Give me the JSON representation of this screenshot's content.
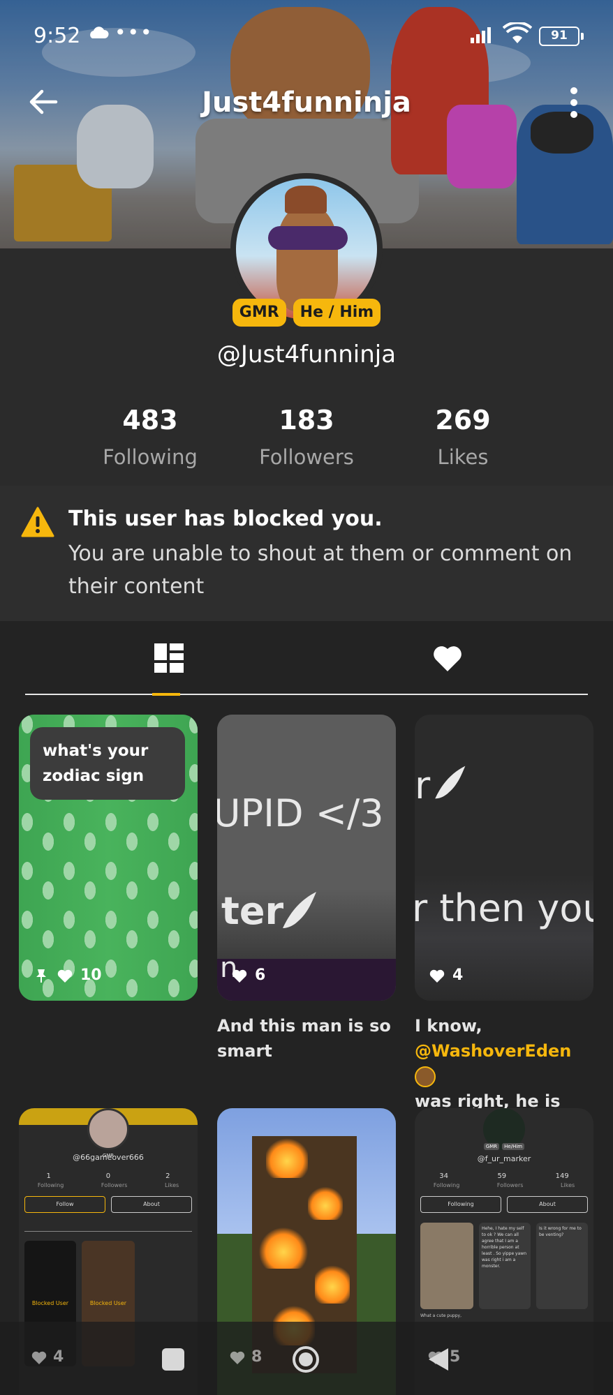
{
  "status_bar": {
    "time": "9:52",
    "dots": "•••",
    "battery": "91"
  },
  "header": {
    "title": "Just4funninja"
  },
  "profile": {
    "badges": [
      "GMR",
      "He / Him"
    ],
    "handle": "@Just4funninja",
    "stats": [
      {
        "value": "483",
        "label": "Following"
      },
      {
        "value": "183",
        "label": "Followers"
      },
      {
        "value": "269",
        "label": "Likes"
      }
    ]
  },
  "notice": {
    "title": "This user has blocked you.",
    "body": "You are unable to shout at them or comment on their content"
  },
  "tabs": [
    {
      "icon": "grid-icon",
      "active": true
    },
    {
      "icon": "heart-icon",
      "active": false
    }
  ],
  "colors": {
    "accent": "#f6b70d",
    "background": "#232323",
    "surface": "#2e2e2e"
  },
  "posts": [
    {
      "bubble": "what's your zodiac sign",
      "likes": "10",
      "caption": ""
    },
    {
      "overlay_top": "UPID </3",
      "overlay_mid": "ter",
      "overlay_bottom": "n",
      "likes": "6",
      "caption": "And this man is so smart"
    },
    {
      "overlay_top": "r",
      "overlay_mid": "r then you,",
      "likes": "4",
      "caption_prefix": "I know, ",
      "caption_mention": "@WashoverEden",
      "caption_suffix": "was right, he is old..."
    },
    {
      "mini_handle": "@66gameover666",
      "mini_badge": "GMR",
      "mini_stats": [
        [
          "1",
          "Following"
        ],
        [
          "0",
          "Followers"
        ],
        [
          "2",
          "Likes"
        ]
      ],
      "mini_follow": "Follow",
      "mini_about": "About",
      "mini_blocked_1": "Blocked User",
      "mini_blocked_2": "Blocked User",
      "likes": "4"
    },
    {
      "likes": "8"
    },
    {
      "mini_handle": "@f_ur_marker",
      "mini_badges": [
        "GMR",
        "He/Him"
      ],
      "mini_stats": [
        [
          "34",
          "Following"
        ],
        [
          "59",
          "Followers"
        ],
        [
          "149",
          "Likes"
        ]
      ],
      "mini_following": "Following",
      "mini_about": "About",
      "mini_post_1": "Hehe, I hate my self to ok ? We can all agree that I am a horrible person at least . So yippe yawn was right i am a monster.",
      "mini_post_2": "Is it wrong for me to be venting?",
      "mini_caption": "What a cute puppy,",
      "likes": "5"
    }
  ]
}
